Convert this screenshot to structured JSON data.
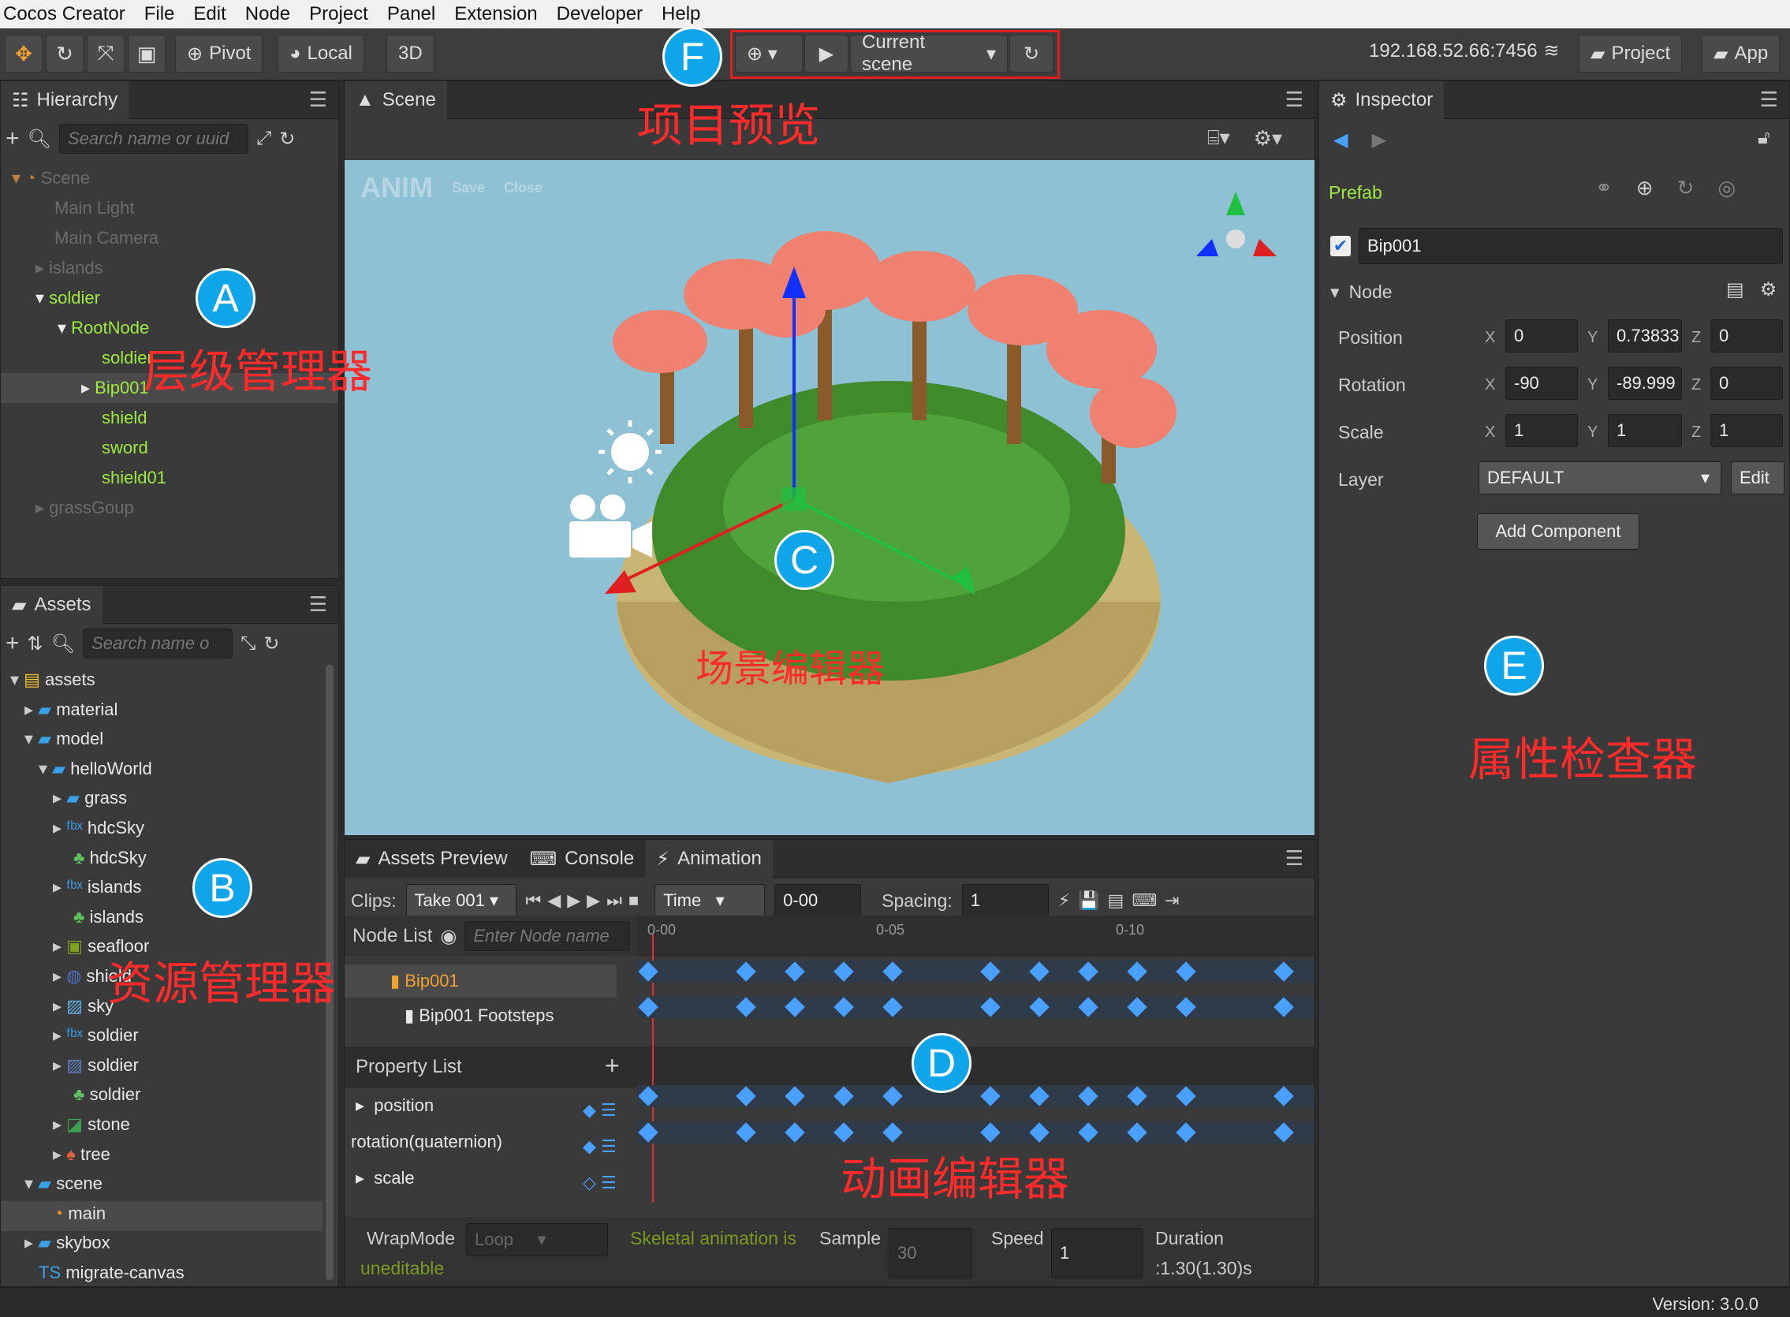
{
  "menu": {
    "app": "Cocos Creator",
    "items": [
      "File",
      "Edit",
      "Node",
      "Project",
      "Panel",
      "Extension",
      "Developer",
      "Help"
    ]
  },
  "toolbar": {
    "pivot": "Pivot",
    "local": "Local",
    "mode3d": "3D",
    "preview_target": "Current scene",
    "ip": "192.168.52.66:7456",
    "project": "Project",
    "app": "App"
  },
  "hierarchy": {
    "tab": "Hierarchy",
    "search_placeholder": "Search name or uuid",
    "nodes": [
      {
        "label": "Scene",
        "style": "dim"
      },
      {
        "label": "Main Light",
        "style": "dim"
      },
      {
        "label": "Main Camera",
        "style": "dim"
      },
      {
        "label": "islands",
        "style": "dim"
      },
      {
        "label": "soldier",
        "style": "green"
      },
      {
        "label": "RootNode",
        "style": "green"
      },
      {
        "label": "soldier",
        "style": "green"
      },
      {
        "label": "Bip001",
        "style": "green"
      },
      {
        "label": "shield",
        "style": "green"
      },
      {
        "label": "sword",
        "style": "green"
      },
      {
        "label": "shield01",
        "style": "green"
      },
      {
        "label": "grassGoup",
        "style": "dim"
      }
    ]
  },
  "assets": {
    "tab": "Assets",
    "search_placeholder": "Search name o",
    "items": [
      "assets",
      "material",
      "model",
      "helloWorld",
      "grass",
      "hdcSky",
      "hdcSky",
      "islands",
      "islands",
      "seafloor",
      "shield",
      "sky",
      "soldier",
      "soldier",
      "soldier",
      "stone",
      "tree",
      "scene",
      "main",
      "skybox",
      "migrate-canvas"
    ]
  },
  "scene": {
    "tab": "Scene",
    "anim_label": "ANIM",
    "anim_save": "Save",
    "anim_close": "Close"
  },
  "bottom": {
    "tabs": [
      "Assets Preview",
      "Console",
      "Animation"
    ],
    "clips_label": "Clips:",
    "clip_value": "Take 001",
    "time_mode": "Time",
    "time_value": "0-00",
    "spacing_label": "Spacing:",
    "spacing_value": "1",
    "node_list": "Node List",
    "node_filter_placeholder": "Enter Node name",
    "ruler": [
      "0-00",
      "0-05",
      "0-10"
    ],
    "nodes": [
      "Bip001",
      "Bip001 Footsteps"
    ],
    "property_list": "Property List",
    "properties": [
      "position",
      "rotation(quaternion)",
      "scale"
    ],
    "wrapmode_label": "WrapMode",
    "wrapmode_value": "Loop",
    "warning": "Skeletal animation is",
    "warning2": "uneditable",
    "sample_label": "Sample",
    "sample_value": "30",
    "speed_label": "Speed",
    "speed_value": "1",
    "duration_label": "Duration",
    "duration_value": ":1.30(1.30)s"
  },
  "inspector": {
    "tab": "Inspector",
    "prefab": "Prefab",
    "node_name": "Bip001",
    "section": "Node",
    "position": {
      "label": "Position",
      "x": "0",
      "y": "0.73833",
      "z": "0"
    },
    "rotation": {
      "label": "Rotation",
      "x": "-90",
      "y": "-89.999",
      "z": "0"
    },
    "scale": {
      "label": "Scale",
      "x": "1",
      "y": "1",
      "z": "1"
    },
    "layer_label": "Layer",
    "layer_value": "DEFAULT",
    "edit": "Edit",
    "add_component": "Add Component"
  },
  "status": {
    "version": "Version: 3.0.0"
  },
  "annotations": {
    "A": "A",
    "B": "B",
    "C": "C",
    "D": "D",
    "E": "E",
    "F": "F",
    "hierarchy": "层级管理器",
    "assets": "资源管理器",
    "scene": "场景编辑器",
    "animation": "动画编辑器",
    "inspector": "属性检查器",
    "preview": "项目预览"
  },
  "colors": {
    "accent_green": "#9eea3f",
    "annotation_red": "#ff2b2b",
    "badge_blue": "#0ea5ea",
    "keyframe": "#4aa0ff",
    "scene_bg": "#8fc1d4"
  }
}
